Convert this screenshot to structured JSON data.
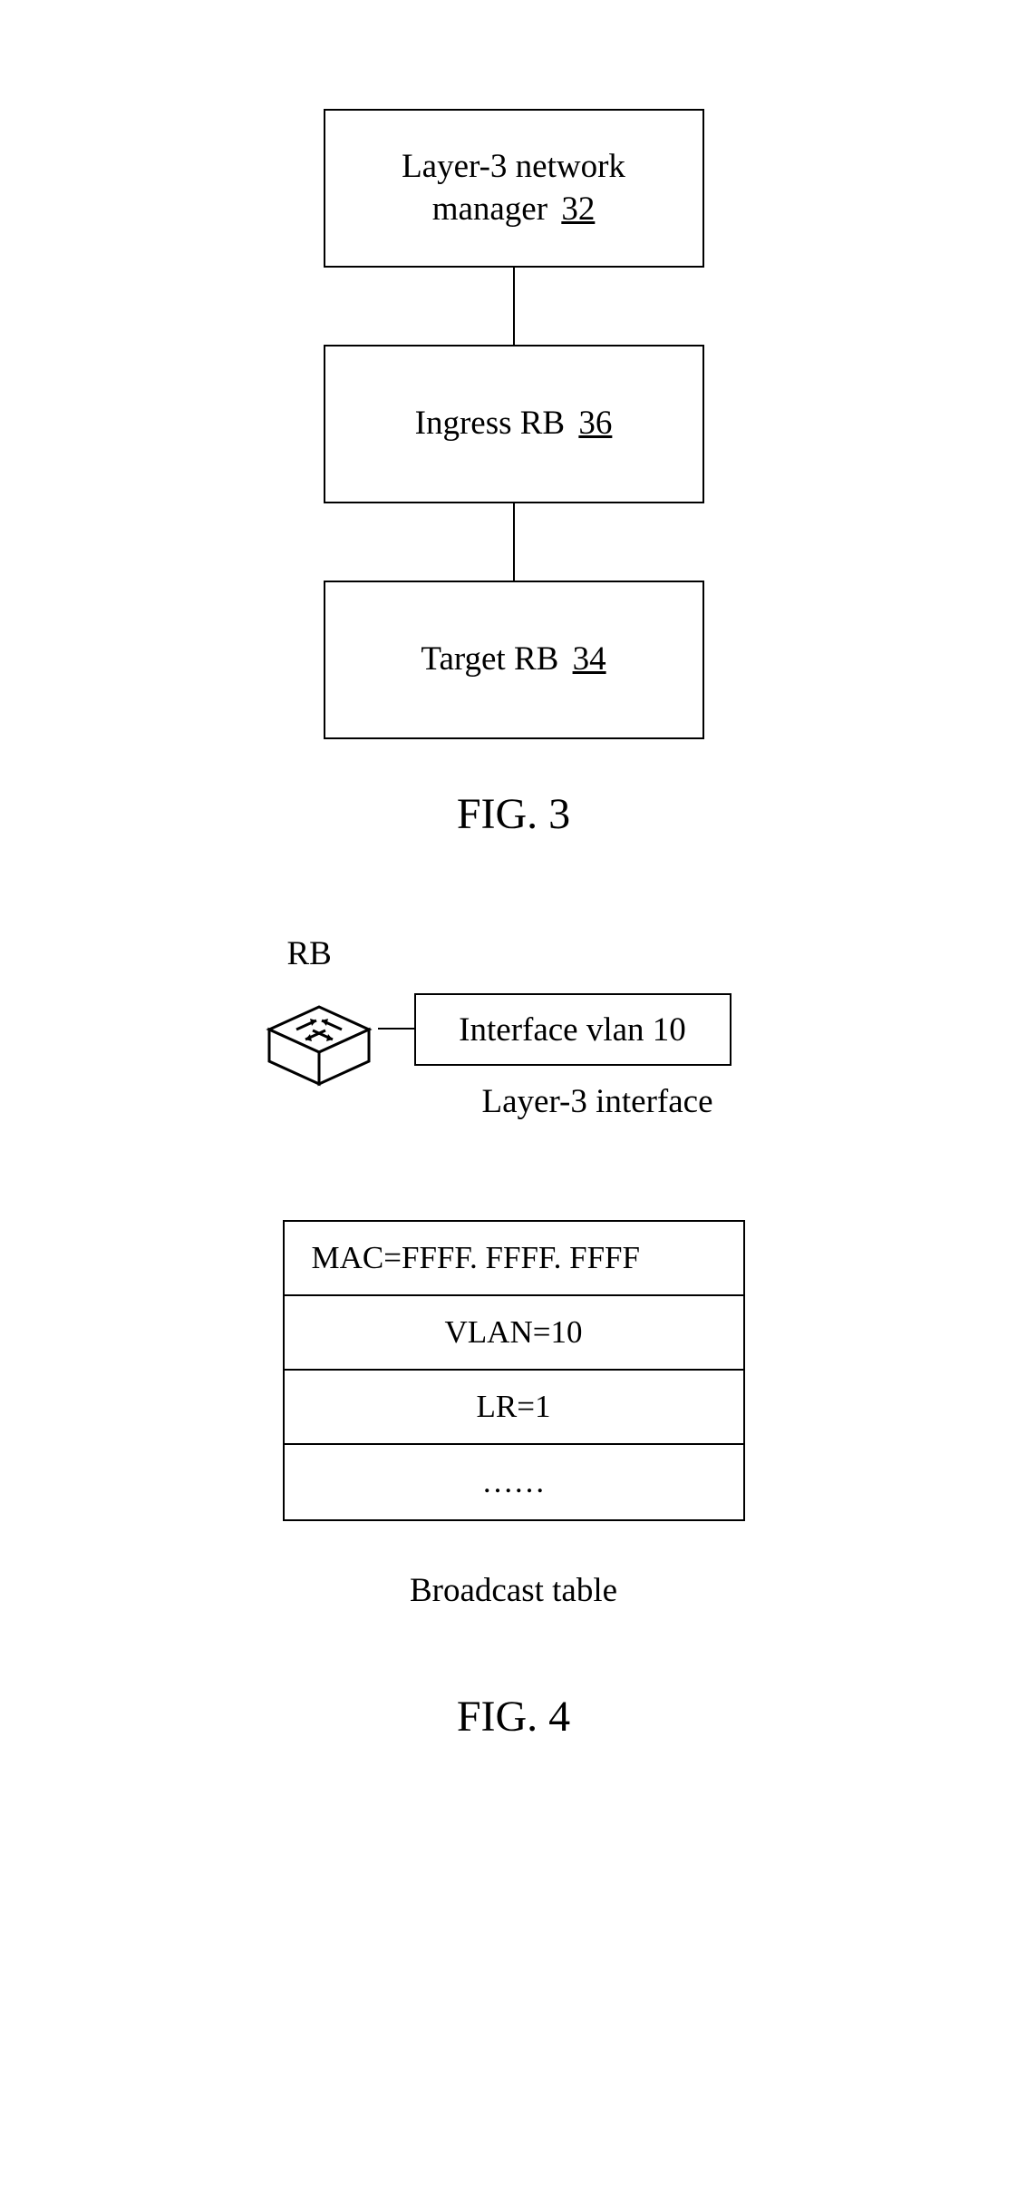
{
  "fig3": {
    "nodes": [
      {
        "label_pre": "Layer-3 network\nmanager",
        "ref": "32"
      },
      {
        "label_pre": "Ingress RB",
        "ref": "36"
      },
      {
        "label_pre": "Target RB",
        "ref": "34"
      }
    ],
    "caption": "FIG. 3"
  },
  "fig4": {
    "rb_label": "RB",
    "interface_label": "Interface vlan 10",
    "interface_note": "Layer-3 interface",
    "broadcast_rows": [
      "MAC=FFFF. FFFF. FFFF",
      "VLAN=10",
      "LR=1",
      "……"
    ],
    "broadcast_caption": "Broadcast table",
    "caption": "FIG. 4"
  }
}
